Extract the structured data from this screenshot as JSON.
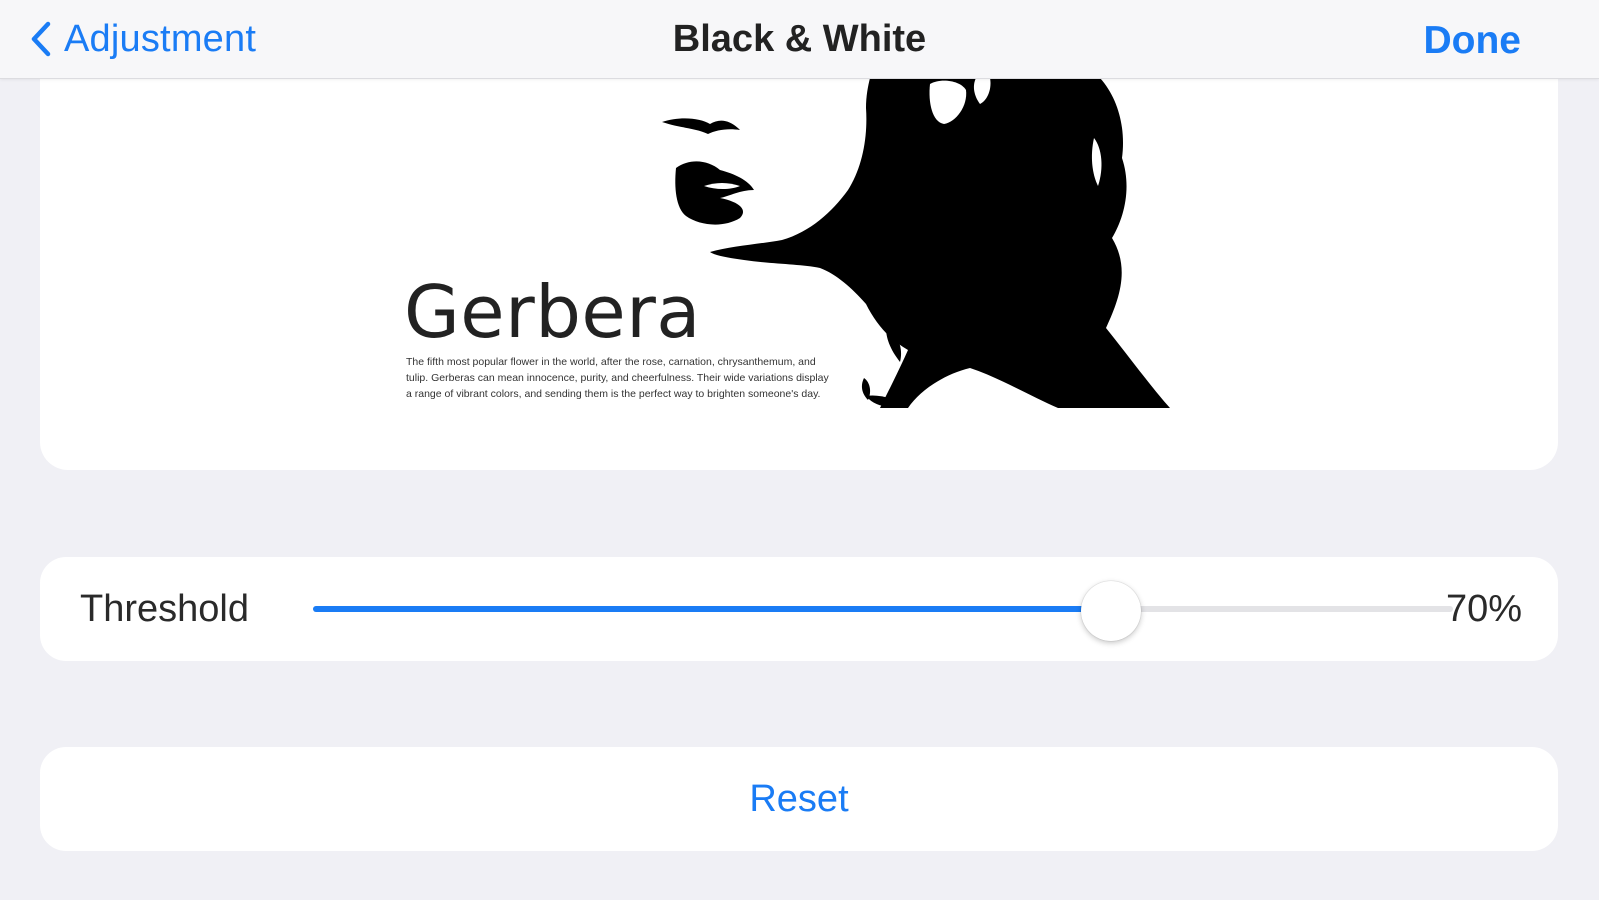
{
  "nav": {
    "back_label": "Adjustment",
    "title": "Black & White",
    "done_label": "Done"
  },
  "preview": {
    "heading": "Gerbera",
    "body": "The fifth most popular flower in the world, after the rose, carnation, chrysanthemum, and tulip. Gerberas can mean innocence, purity, and cheerfulness. Their wide variations display a range of vibrant colors, and sending them is the perfect way to brighten someone's day."
  },
  "threshold": {
    "label": "Threshold",
    "value_text": "70%",
    "level": 0.7
  },
  "reset_label": "Reset",
  "colors": {
    "accent": "#1a7cf5",
    "background": "#f0f0f5",
    "card": "#ffffff"
  },
  "icons": {
    "back": "chevron-left-icon"
  }
}
